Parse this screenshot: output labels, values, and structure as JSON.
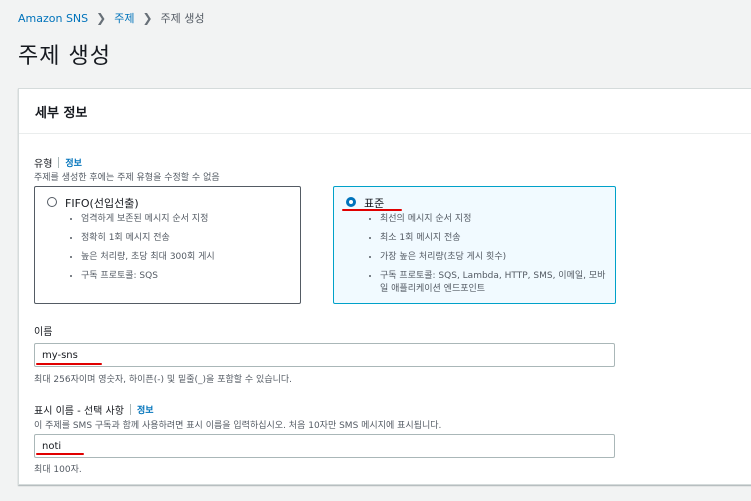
{
  "breadcrumb": {
    "items": [
      "Amazon SNS",
      "주제"
    ],
    "current": "주제 생성"
  },
  "page": {
    "title": "주제 생성"
  },
  "panel": {
    "title": "세부 정보"
  },
  "type": {
    "label": "유형",
    "info": "정보",
    "description": "주제를 생성한 후에는 주제 유형을 수정할 수 없음",
    "options": [
      {
        "title": "FIFO(선입선출)",
        "selected": false,
        "bullets": [
          "엄격하게 보존된 메시지 순서 지정",
          "정확히 1회 메시지 전송",
          "높은 처리량, 초당 최대 300회 게시",
          "구독 프로토콜: SQS"
        ]
      },
      {
        "title": "표준",
        "selected": true,
        "bullets": [
          "최선의 메시지 순서 지정",
          "최소 1회 메시지 전송",
          "가장 높은 처리량(초당 게시 횟수)",
          "구독 프로토콜: SQS, Lambda, HTTP, SMS, 이메일, 모바일 애플리케이션 엔드포인트"
        ]
      }
    ]
  },
  "name": {
    "label": "이름",
    "value": "my-sns",
    "hint": "최대 256자이며 영숫자, 하이픈(-) 및 밑줄(_)을 포함할 수 있습니다."
  },
  "display_name": {
    "label": "표시 이름 - 선택 사항",
    "info": "정보",
    "description": "이 주제를 SMS 구독과 함께 사용하려면 표시 이름을 입력하십시오. 처음 10자만 SMS 메시지에 표시됩니다.",
    "value": "noti",
    "hint": "최대 100자."
  },
  "colors": {
    "accent": "#0073bb",
    "selected_border": "#00a1c9",
    "annotation": "#e00000"
  }
}
